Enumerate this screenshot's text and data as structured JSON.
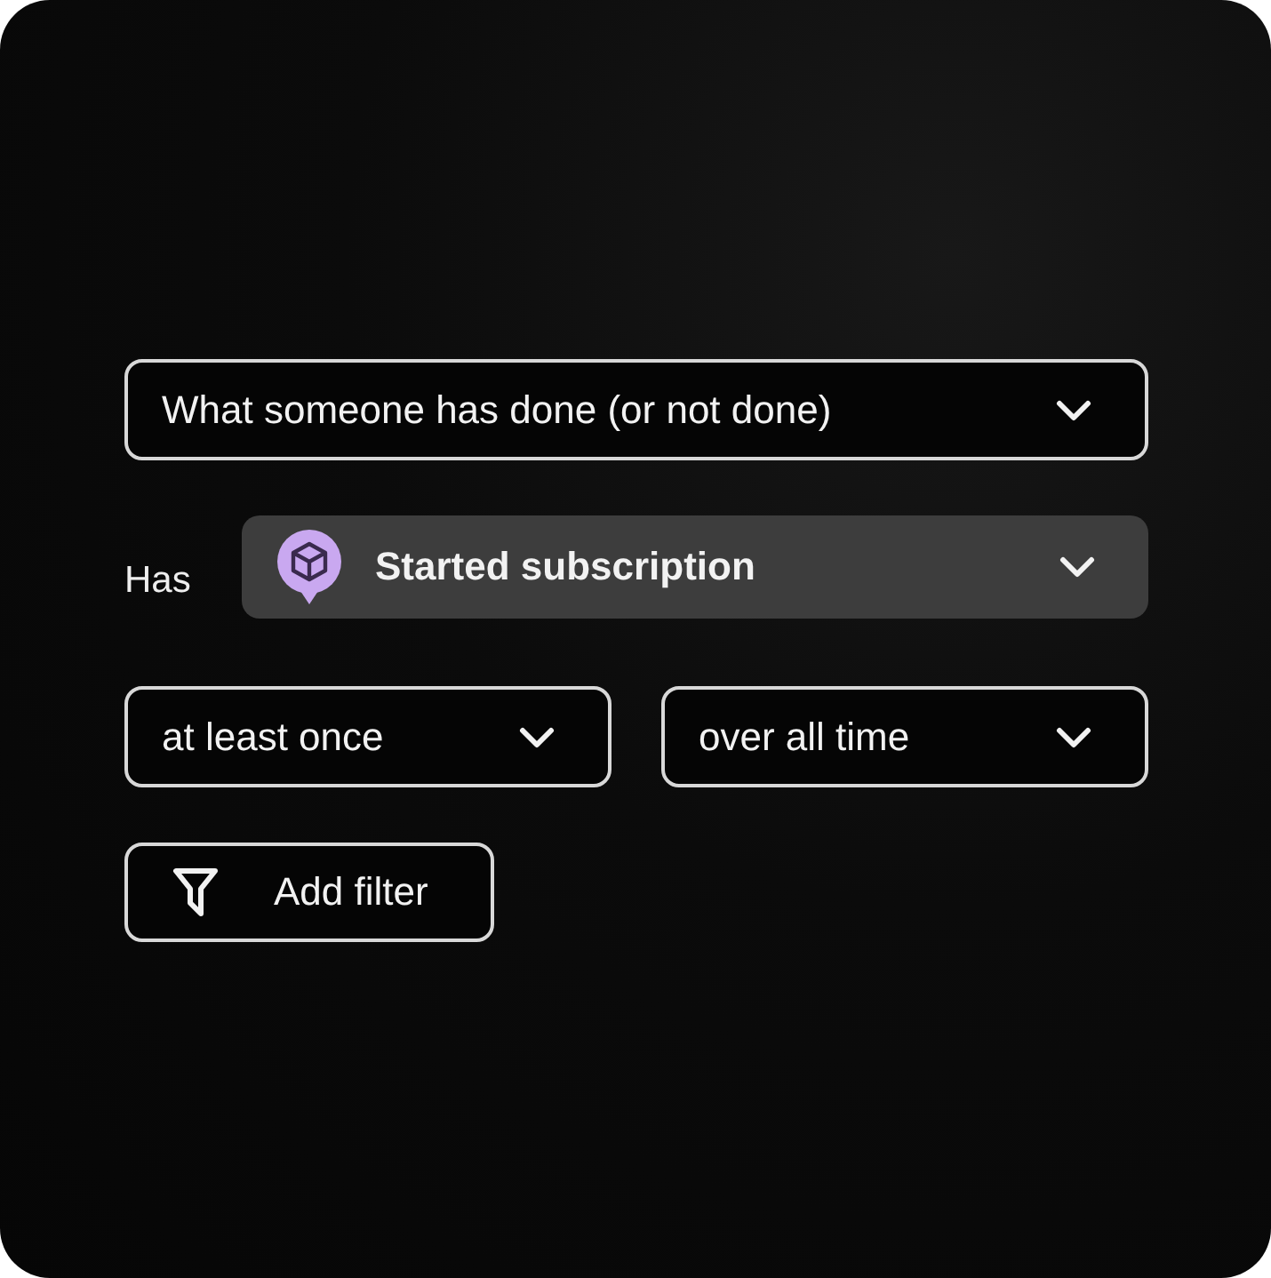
{
  "condition_type": {
    "value": "What someone has done (or not done)"
  },
  "event": {
    "label": "Has",
    "value": "Started subscription"
  },
  "frequency": {
    "value": "at least once"
  },
  "time_range": {
    "value": "over all time"
  },
  "add_filter": {
    "label": "Add filter"
  }
}
